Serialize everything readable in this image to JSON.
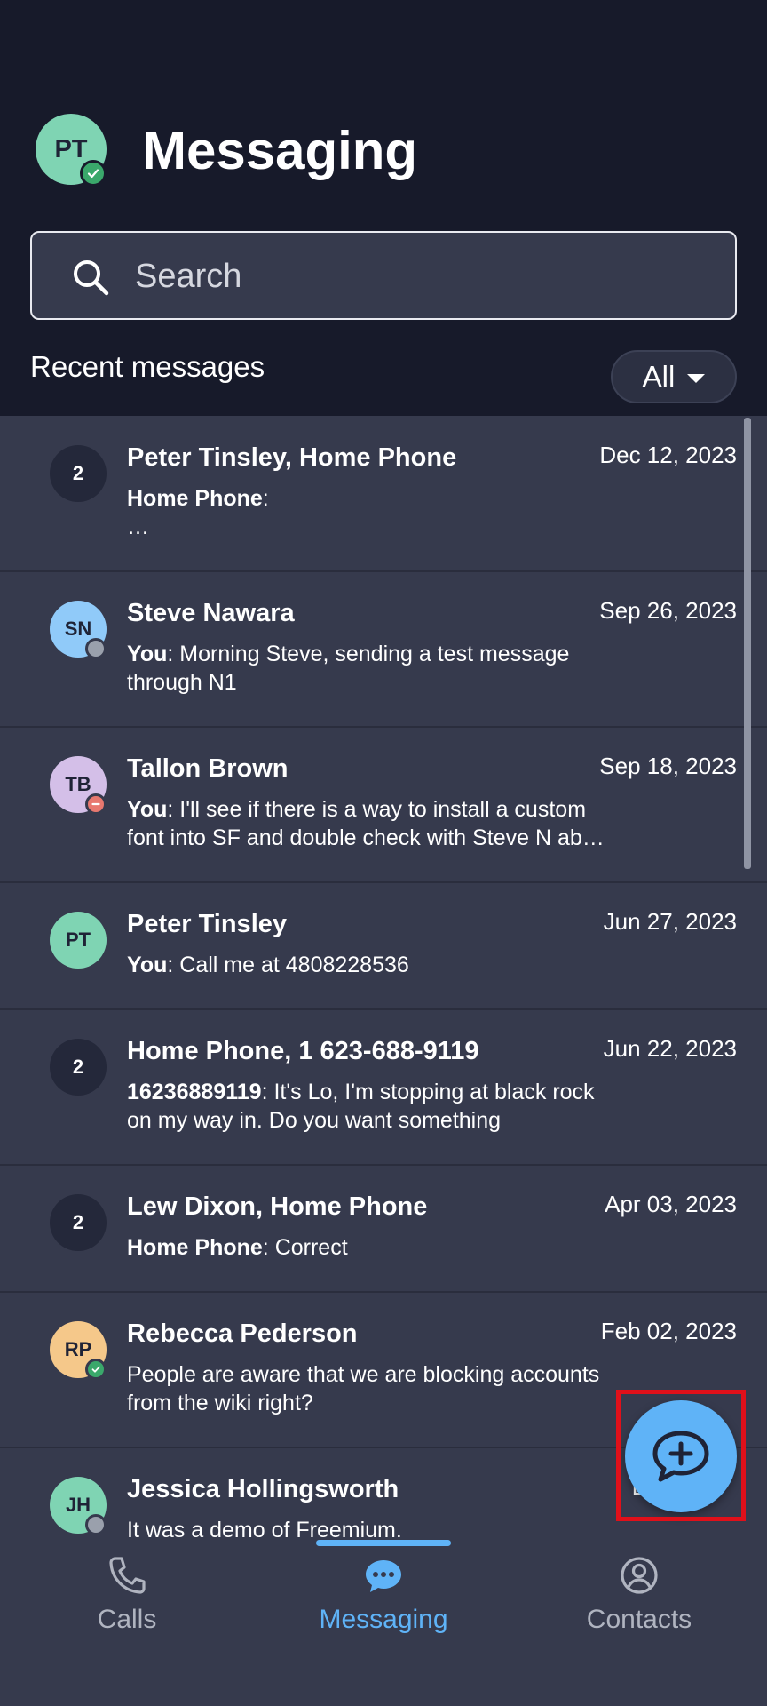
{
  "header": {
    "avatar_initials": "PT",
    "title": "Messaging",
    "search_placeholder": "Search",
    "section_label": "Recent messages",
    "filter_label": "All"
  },
  "conversations": [
    {
      "badge": "2",
      "name": "Peter Tinsley, Home Phone",
      "date": "Dec 12, 2023",
      "sender": "Home Phone",
      "sep": ":",
      "text": "",
      "line2": "…"
    },
    {
      "badge": "SN",
      "name": "Steve Nawara",
      "date": "Sep 26, 2023",
      "sender": "You",
      "sep": ":",
      "text": " Morning Steve, sending a test message through N1"
    },
    {
      "badge": "TB",
      "name": "Tallon Brown",
      "date": "Sep 18, 2023",
      "sender": "You",
      "sep": ":",
      "text": " I'll see if there is a way to install a custom font into SF and double check with Steve N ab…"
    },
    {
      "badge": "PT",
      "name": "Peter Tinsley",
      "date": "Jun 27, 2023",
      "sender": "You",
      "sep": ":",
      "text": " Call me at 4808228536"
    },
    {
      "badge": "2",
      "name": "Home Phone, 1 623-688-9119",
      "date": "Jun 22, 2023",
      "sender": "16236889119",
      "sep": ":",
      "text": " It's Lo, I'm stopping at black rock on my way in. Do you want something"
    },
    {
      "badge": "2",
      "name": "Lew Dixon, Home Phone",
      "date": "Apr 03, 2023",
      "sender": "Home Phone",
      "sep": ":",
      "text": " Correct"
    },
    {
      "badge": "RP",
      "name": "Rebecca Pederson",
      "date": "Feb 02, 2023",
      "sender": "",
      "sep": "",
      "text": " People are aware that we are blocking accounts from the wiki right?"
    },
    {
      "badge": "JH",
      "name": "Jessica Hollingsworth",
      "date": "Dec",
      "sender": "",
      "sep": "",
      "text": " It was a demo of Freemium."
    }
  ],
  "colors": {
    "accent": "#5fb3f7",
    "header_bg": "#171a2a",
    "list_bg": "#363a4d",
    "presence_available": "#3aa86b",
    "presence_offline": "#9aa0ac",
    "presence_busy": "#e8786f",
    "highlight": "#e0101a"
  },
  "fab": {
    "icon": "chat-plus-icon"
  },
  "nav": {
    "calls": "Calls",
    "messaging": "Messaging",
    "contacts": "Contacts",
    "active": "messaging"
  }
}
